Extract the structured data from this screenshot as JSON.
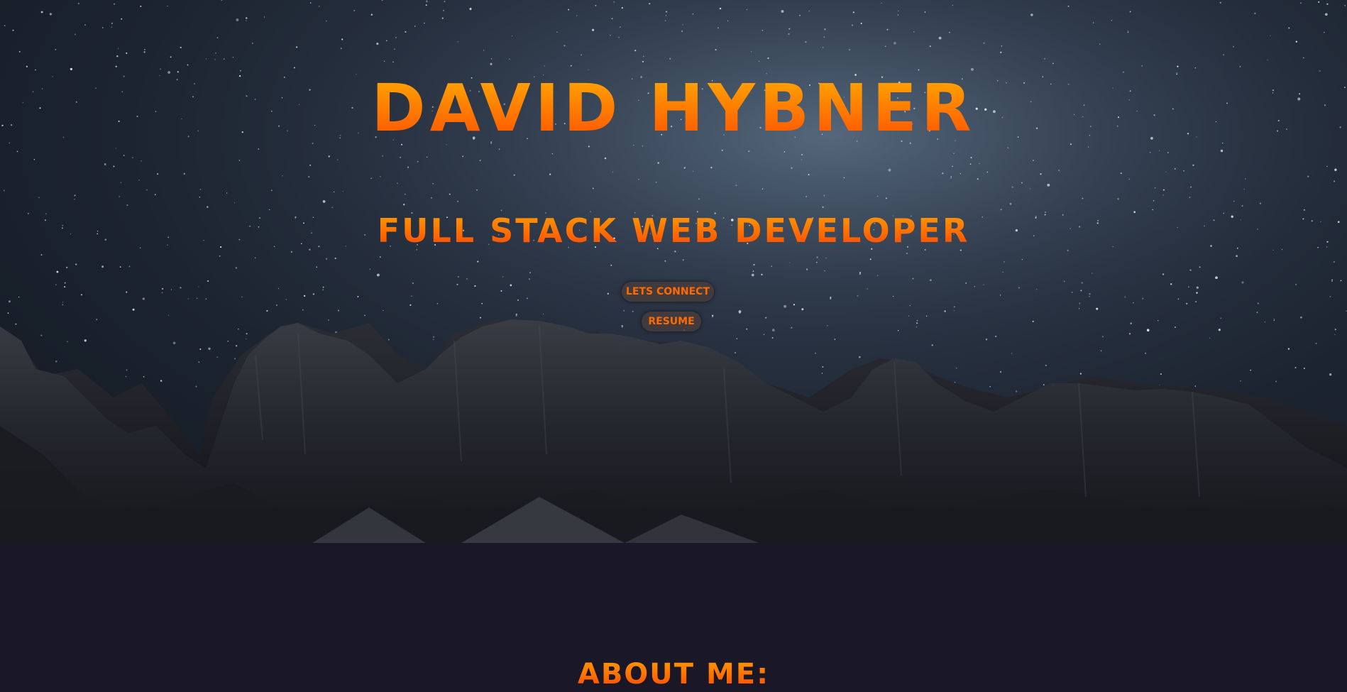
{
  "hero": {
    "title": "DAVID HYBNER",
    "subtitle": "FULL STACK WEB DEVELOPER",
    "connect_label": "LETS CONNECT",
    "resume_label": "RESUME"
  },
  "about": {
    "heading": "ABOUT ME:"
  },
  "colors": {
    "accent_top": "#ffb000",
    "accent_bottom": "#ff4400",
    "page_background": "#1a1726",
    "button_background": "#463c3c"
  }
}
